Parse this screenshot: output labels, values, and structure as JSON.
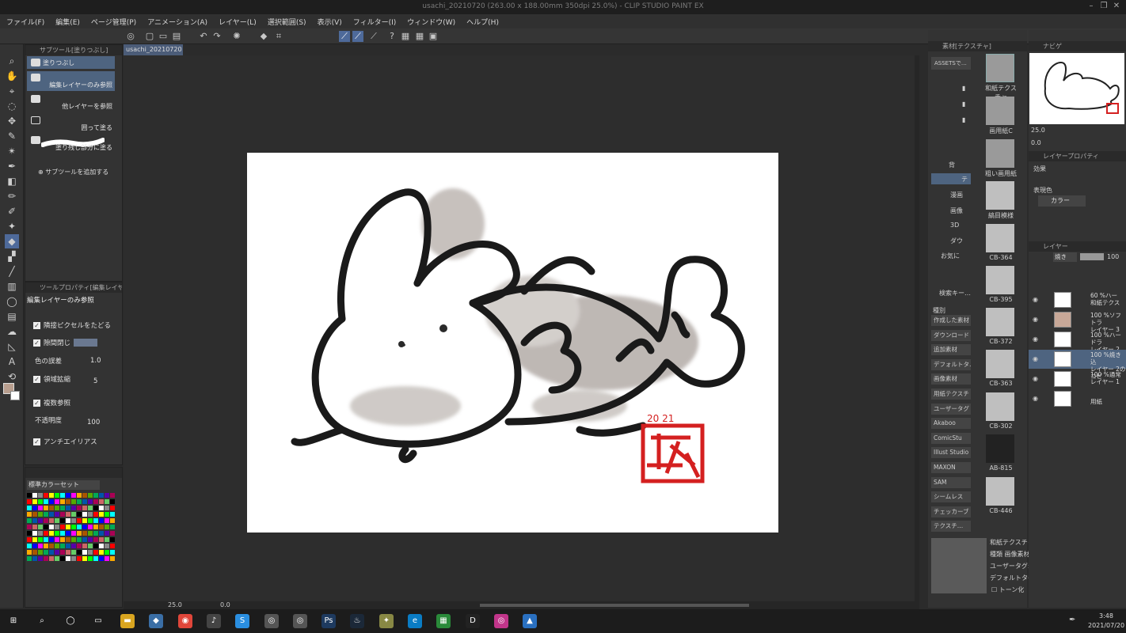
{
  "window": {
    "title": "usachi_20210720 (263.00 x 188.00mm 350dpi 25.0%)  - CLIP STUDIO PAINT EX"
  },
  "menu": [
    "ファイル(F)",
    "編集(E)",
    "ページ管理(P)",
    "アニメーション(A)",
    "レイヤー(L)",
    "選択範囲(S)",
    "表示(V)",
    "フィルター(I)",
    "ウィンドウ(W)",
    "ヘルプ(H)"
  ],
  "doc_tab": "usachi_20210720",
  "subtool": {
    "header": "サブツール[塗りつぶし]",
    "items": [
      "塗りつぶし",
      "編集レイヤーのみ参照",
      "他レイヤーを参照",
      "囲って塗る",
      "塗り残し部分に塗る"
    ],
    "add_label": "サブツールを追加する"
  },
  "toolprop": {
    "header": "ツールプロパティ[編集レイヤー…",
    "title": "編集レイヤーのみ参照",
    "follow": "隣接ピクセルをたどる",
    "close_gap": "隙間閉じ",
    "color_margin": "色の誤差",
    "color_margin_val": "1.0",
    "expand": "領域拡縮",
    "expand_val": "5",
    "multi_ref": "複数参照",
    "opacity": "不透明度",
    "opacity_val": "100",
    "antialias": "アンチエイリアス"
  },
  "colorset": {
    "name": "標準カラーセット"
  },
  "status": {
    "zoom": "25.0",
    "angle": "0.0"
  },
  "material": {
    "header": "素材[テクスチャ]",
    "assets": "ASSETSで…",
    "tree": [
      "背",
      "テ",
      "漫画",
      "画像",
      "3D",
      "ダウ",
      "お気に"
    ],
    "search": "検索キー…",
    "kind": "種別",
    "tags": [
      "作成した素材",
      "ダウンロード",
      "追加素材",
      "デフォルトタ…",
      "画像素材",
      "用紙テクスチ",
      "ユーザータグ",
      "Akaboo",
      "ComicStu",
      "Illust Studio",
      "MAXON",
      "SAM",
      "シームレス",
      "チェッカーブ",
      "テクスチ…"
    ],
    "thumbs": [
      "和紙テクスチャ",
      "画用紙C",
      "粗い画用紙",
      "縞目模様",
      "CB-364",
      "CB-395",
      "CB-372",
      "CB-363",
      "CB-302",
      "AB-815",
      "CB-446"
    ],
    "info": [
      "和紙テクスチャ",
      "種類  画像素材",
      "ユーザータグ:",
      "デフォルトタグ:",
      "トーン化"
    ]
  },
  "navigator": {
    "label": "ナビゲ",
    "zoom": "25.0",
    "angle": "0.0"
  },
  "layerprop": {
    "label": "レイヤープロパティ",
    "effect": "効果",
    "color_label": "表現色",
    "color_value": "カラー"
  },
  "layers": {
    "label": "レイヤー",
    "blend": "焼き",
    "opacity": "100",
    "items": [
      {
        "pct": "60 %ハー",
        "name": "和紙テクス"
      },
      {
        "pct": "100 %ソフトラ",
        "name": "レイヤー 3"
      },
      {
        "pct": "100 %ハードラ",
        "name": "レイヤー 2"
      },
      {
        "pct": "100 %焼き込",
        "name": "レイヤー 2のコピ"
      },
      {
        "pct": "100 %通常",
        "name": "レイヤー 1"
      },
      {
        "pct": "",
        "name": "用紙"
      }
    ]
  },
  "taskbar": {
    "time": "3:48",
    "date": "2021/07/20"
  },
  "colors": {
    "accent": "#4e6a9a",
    "stamp": "#d42020",
    "ink": "#1a1a1a"
  }
}
